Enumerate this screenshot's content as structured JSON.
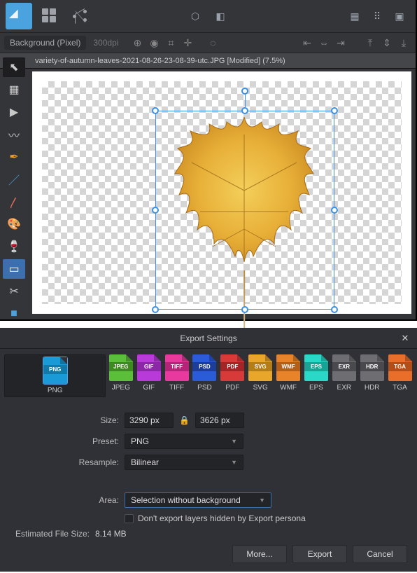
{
  "context": {
    "layer_label": "Background (Pixel)",
    "dpi": "300dpi"
  },
  "document": {
    "tab_title": "variety-of-autumn-leaves-2021-08-26-23-08-39-utc.JPG [Modified] (7.5%)"
  },
  "export": {
    "title": "Export Settings",
    "formats": [
      {
        "code": "PNG",
        "label": "PNG",
        "color": "#1a9ad6",
        "band": "#1279a8"
      },
      {
        "code": "JPEG",
        "label": "JPEG",
        "color": "#5bbf3a",
        "band": "#3d8a25"
      },
      {
        "code": "GIF",
        "label": "GIF",
        "color": "#b83ad8",
        "band": "#8c27a8"
      },
      {
        "code": "TIFF",
        "label": "TIFF",
        "color": "#e83a9e",
        "band": "#b32578"
      },
      {
        "code": "PSD",
        "label": "PSD",
        "color": "#2a5bd8",
        "band": "#1c3e99"
      },
      {
        "code": "PDF",
        "label": "PDF",
        "color": "#d83a3a",
        "band": "#a32525"
      },
      {
        "code": "SVG",
        "label": "SVG",
        "color": "#e8a62a",
        "band": "#b37d18"
      },
      {
        "code": "WMF",
        "label": "WMF",
        "color": "#e8832a",
        "band": "#b35f18"
      },
      {
        "code": "EPS",
        "label": "EPS",
        "color": "#2ad8c8",
        "band": "#18a394"
      },
      {
        "code": "EXR",
        "label": "EXR",
        "color": "#6e6e72",
        "band": "#4a4a4e"
      },
      {
        "code": "HDR",
        "label": "HDR",
        "color": "#6e6e72",
        "band": "#4a4a4e"
      },
      {
        "code": "TGA",
        "label": "TGA",
        "color": "#e86e2a",
        "band": "#b34e18"
      }
    ],
    "selected_format": "PNG",
    "labels": {
      "size": "Size:",
      "preset": "Preset:",
      "resample": "Resample:",
      "area": "Area:",
      "hidden_layers": "Don't export layers hidden by Export persona",
      "est": "Estimated File Size:"
    },
    "values": {
      "width": "3290 px",
      "height": "3626 px",
      "preset": "PNG",
      "resample": "Bilinear",
      "area": "Selection without background",
      "est": "8.14 MB"
    },
    "buttons": {
      "more": "More...",
      "export": "Export",
      "cancel": "Cancel"
    }
  }
}
